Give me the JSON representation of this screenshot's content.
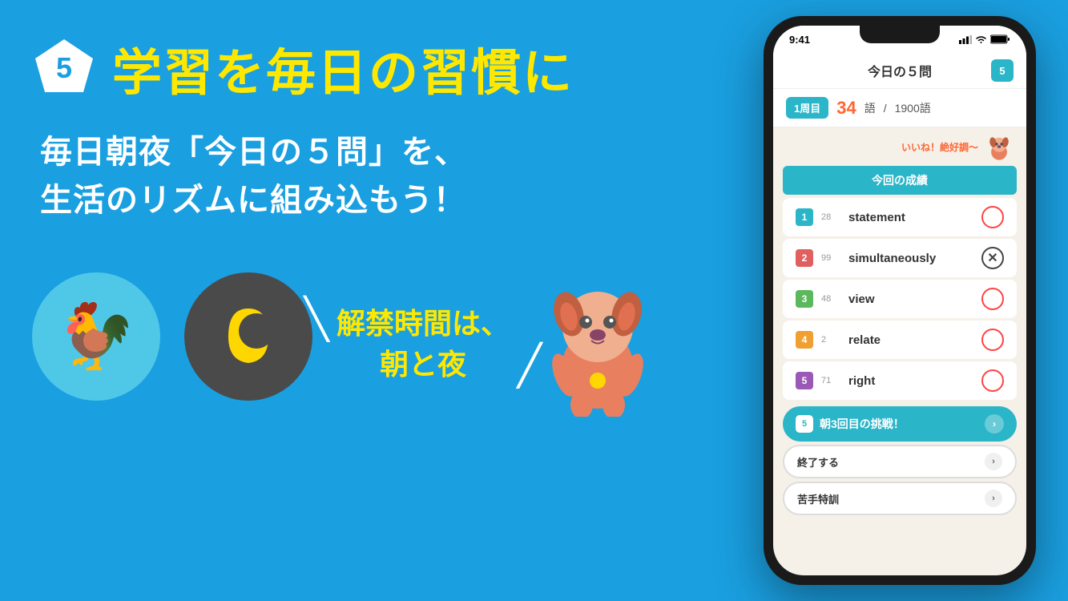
{
  "background_color": "#1a9fe0",
  "left": {
    "badge_number": "5",
    "main_title": "学習を毎日の習慣に",
    "subtitle_line1": "毎日朝夜「今日の５問」を、",
    "subtitle_line2": "生活のリズムに組み込もう！",
    "unlock_text_line1": "解禁時間は、",
    "unlock_text_line2": "朝と夜",
    "rooster_emoji": "🐓",
    "moon_emoji": "🌙"
  },
  "phone": {
    "status_time": "9:41",
    "status_icons": "▲▲ ⊙ ▬",
    "header_title": "今日の５問",
    "header_badge": "5",
    "streak_label": "1周目",
    "streak_count": "34",
    "streak_word": "語",
    "streak_separator": "/",
    "streak_total": "1900語",
    "praise_text": "いいね！絶好調～",
    "results_header": "今回の成績",
    "results": [
      {
        "num": "1",
        "id": "28",
        "word": "statement",
        "correct": true
      },
      {
        "num": "2",
        "id": "99",
        "word": "simultaneously",
        "correct": false
      },
      {
        "num": "3",
        "id": "48",
        "word": "view",
        "correct": true
      },
      {
        "num": "4",
        "id": "2",
        "word": "relate",
        "correct": true
      },
      {
        "num": "5",
        "id": "71",
        "word": "right",
        "correct": true
      }
    ],
    "challenge_badge": "5",
    "challenge_label": "朝3回目の挑戦！",
    "end_button_label": "終了する",
    "weak_button_label": "苦手特訓"
  }
}
